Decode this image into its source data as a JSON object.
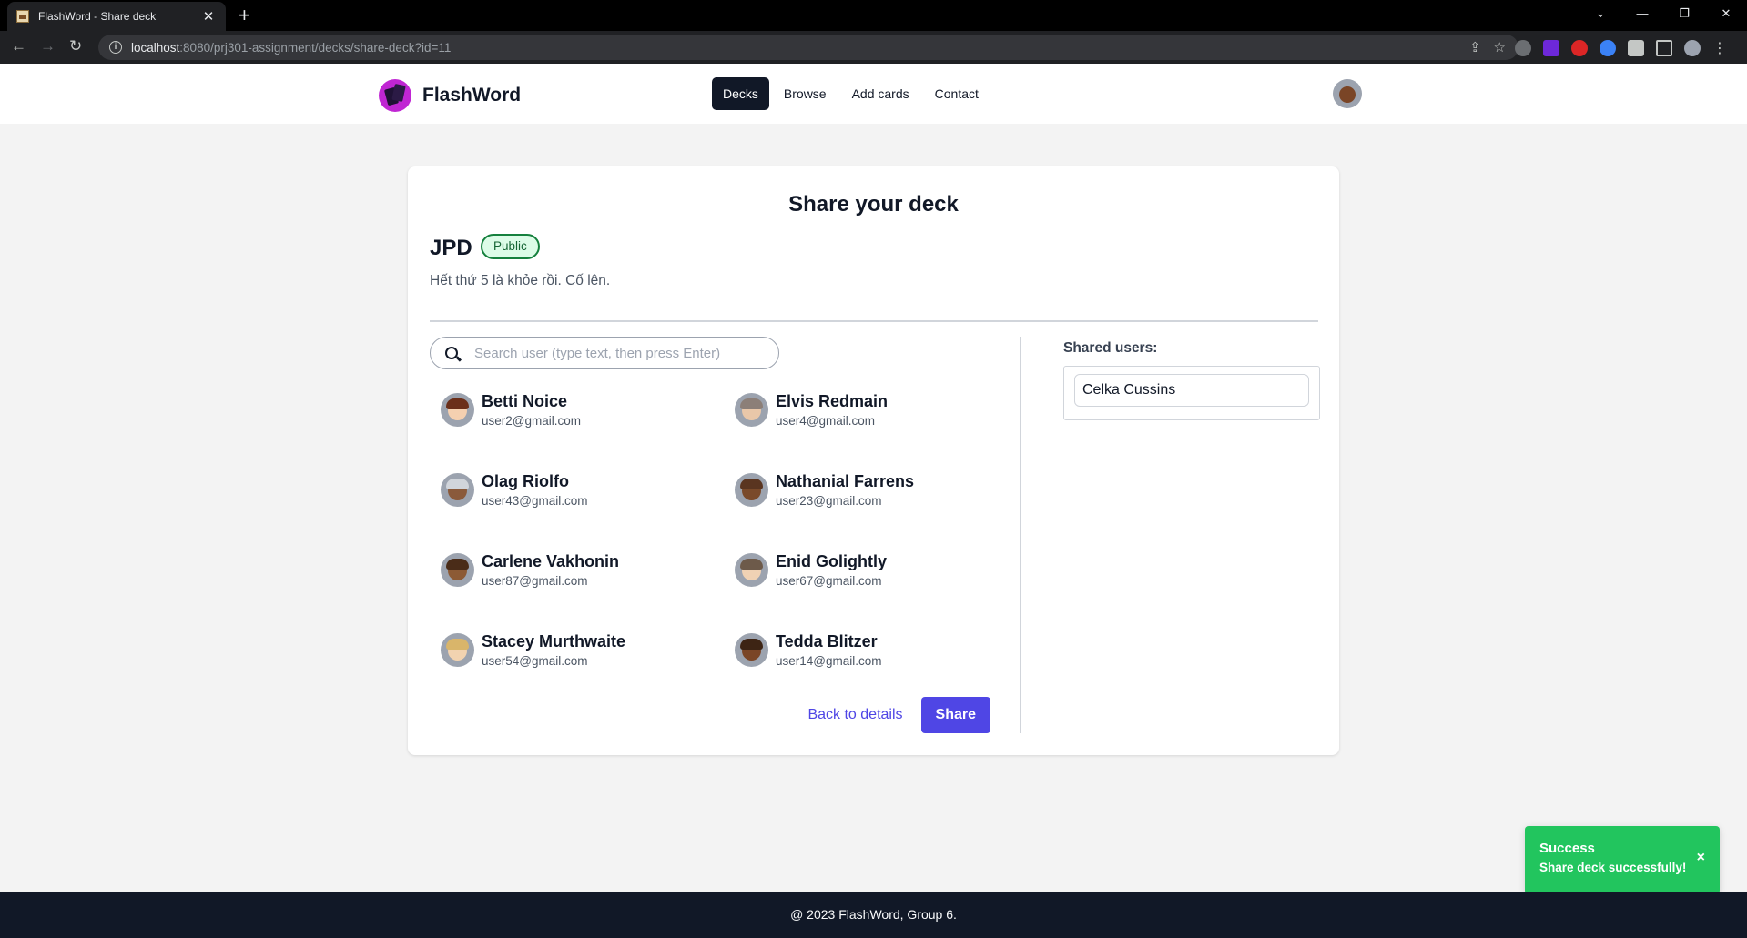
{
  "browser": {
    "tab_title": "FlashWord - Share deck",
    "url_host": "localhost",
    "url_path": ":8080/prj301-assignment/decks/share-deck?id=11"
  },
  "header": {
    "brand": "FlashWord",
    "nav": [
      "Decks",
      "Browse",
      "Add cards",
      "Contact"
    ],
    "active_nav": "Decks"
  },
  "page": {
    "title": "Share your deck",
    "deck_name": "JPD",
    "deck_visibility": "Public",
    "deck_description": "Hết thứ 5 là khỏe rồi. Cố lên.",
    "search_placeholder": "Search user (type text, then press Enter)",
    "search_value": "",
    "users": [
      {
        "name": "Betti Noice",
        "email": "user2@gmail.com",
        "skin": "#f5d0b0",
        "hair": "#6b2f1a"
      },
      {
        "name": "Elvis Redmain",
        "email": "user4@gmail.com",
        "skin": "#e9c7a9",
        "hair": "#8c7f78"
      },
      {
        "name": "Olag Riolfo",
        "email": "user43@gmail.com",
        "skin": "#8a5a3b",
        "hair": "#d1d5db"
      },
      {
        "name": "Nathanial Farrens",
        "email": "user23@gmail.com",
        "skin": "#7a4a2a",
        "hair": "#5a3520"
      },
      {
        "name": "Carlene Vakhonin",
        "email": "user87@gmail.com",
        "skin": "#8c5a35",
        "hair": "#4a2c18"
      },
      {
        "name": "Enid Golightly",
        "email": "user67@gmail.com",
        "skin": "#f0d2b4",
        "hair": "#6d5a4a"
      },
      {
        "name": "Stacey Murthwaite",
        "email": "user54@gmail.com",
        "skin": "#f2d3b0",
        "hair": "#d9b56a"
      },
      {
        "name": "Tedda Blitzer",
        "email": "user14@gmail.com",
        "skin": "#7a4526",
        "hair": "#3d2414"
      }
    ],
    "back_label": "Back to details",
    "share_label": "Share",
    "shared_label": "Shared users:",
    "shared_users": [
      "Celka Cussins"
    ]
  },
  "toast": {
    "title": "Success",
    "message": "Share deck successfully!",
    "close": "×"
  },
  "footer": {
    "text": "@ 2023 FlashWord, Group 6."
  },
  "colors": {
    "primary": "#4f46e5",
    "dark": "#111827",
    "success": "#22c55e",
    "badge_border": "#15803d",
    "badge_bg": "#dcfce7"
  }
}
